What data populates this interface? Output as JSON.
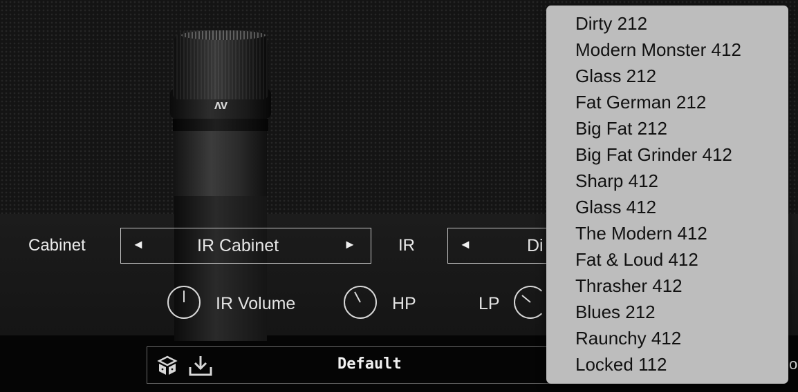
{
  "cabinet": {
    "label": "Cabinet",
    "prev_arrow": "◄",
    "next_arrow": "►",
    "value": "IR Cabinet"
  },
  "ir": {
    "label": "IR",
    "prev_arrow": "◄",
    "value": "Di"
  },
  "knobs": {
    "ir_volume": {
      "label": "IR Volume"
    },
    "hp": {
      "label": "HP"
    },
    "lp": {
      "label": "LP"
    }
  },
  "mic": {
    "logo": "ʌv"
  },
  "preset": {
    "name": "Default",
    "trailing_text": "o"
  },
  "icons": {
    "randomize": "randomize-icon",
    "save": "download-icon"
  },
  "dropdown": {
    "items": [
      "Dirty 212",
      "Modern Monster 412",
      "Glass 212",
      "Fat German 212",
      "Big Fat 212",
      "Big Fat Grinder 412",
      "Sharp 412",
      "Glass 412",
      "The Modern 412",
      "Fat & Loud 412",
      "Thrasher 412",
      "Blues 212",
      "Raunchy 412",
      "Locked 112"
    ]
  },
  "colors": {
    "menu_bg": "#bdbdbd",
    "panel_bg": "#1a1a1a",
    "text_light": "#eaeaea"
  }
}
